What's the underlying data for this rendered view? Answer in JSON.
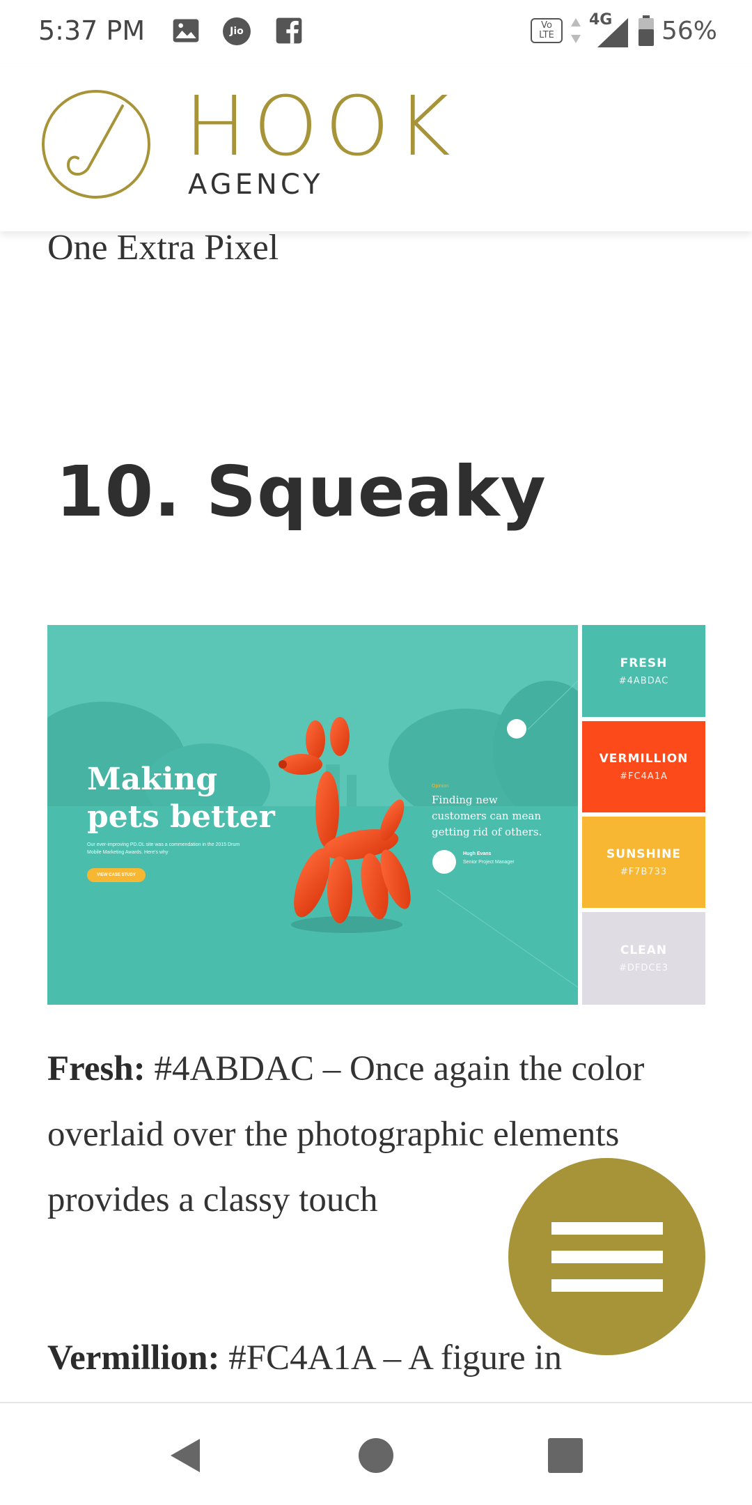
{
  "status_bar": {
    "time": "5:37 PM",
    "left_icons": [
      "gallery-icon",
      "jio-icon",
      "facebook-icon"
    ],
    "jio_label": "Jio",
    "volte_label": "Vo LTE",
    "network_label": "4G",
    "battery_percent": "56%"
  },
  "header": {
    "logo_primary": "HOOK",
    "logo_secondary": "AGENCY",
    "brand_color": "#a89438"
  },
  "article": {
    "previous_caption": "One Extra Pixel",
    "section_title": "10. Squeaky",
    "hero": {
      "headline": "Making pets better",
      "body_small": "Our ever-improving PD.OL site was a commendation in the 2015 Drum Mobile Marketing Awards. Here's why",
      "cta_label": "VIEW CASE STUDY",
      "quote_tag": "Opinion",
      "quote_text": "Finding new customers can mean getting rid of others.",
      "author_name": "Hugh Evans",
      "author_role": "Senior Project Manager",
      "swatches": [
        {
          "name": "FRESH",
          "hex": "#4ABDAC",
          "color": "#4ABDAC"
        },
        {
          "name": "VERMILLION",
          "hex": "#FC4A1A",
          "color": "#FC4A1A"
        },
        {
          "name": "SUNSHINE",
          "hex": "#F7B733",
          "color": "#F7B733"
        },
        {
          "name": "CLEAN",
          "hex": "#DFDCE3",
          "color": "#DFDCE3"
        }
      ]
    },
    "paragraph1": {
      "label": "Fresh:",
      "text": " #4ABDAC – Once again the color overlaid over the photographic elements provides a classy touch"
    },
    "paragraph2": {
      "label": "Vermillion:",
      "text": " #FC4A1A – A figure in"
    }
  },
  "fab": {
    "icon": "menu-icon"
  },
  "nav_bar": {
    "buttons": [
      "back-icon",
      "home-icon",
      "recents-icon"
    ]
  }
}
